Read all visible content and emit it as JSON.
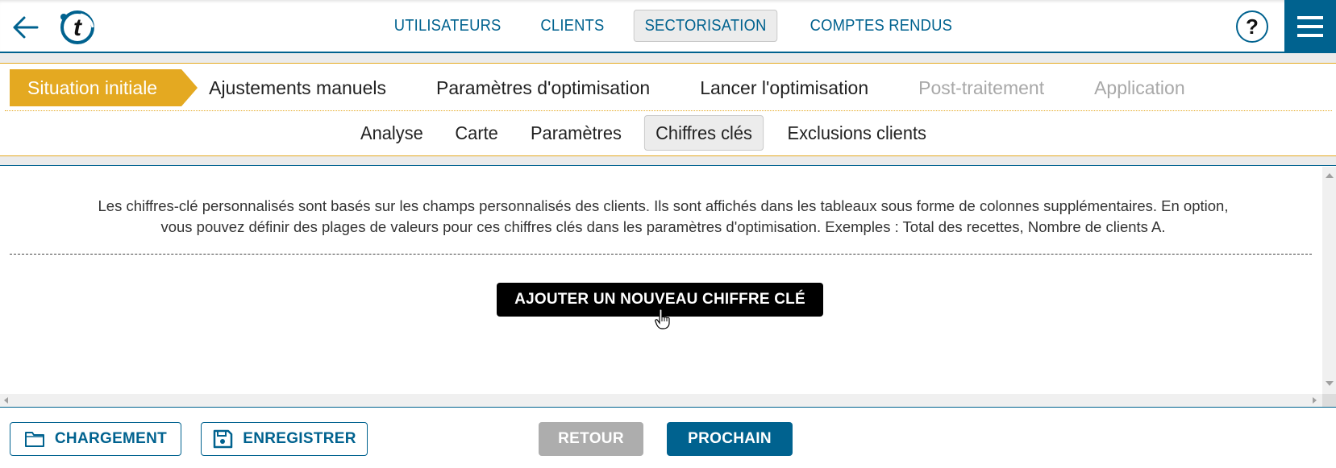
{
  "header": {
    "back_icon": "arrow-left-icon",
    "logo_letter": "t",
    "nav": [
      {
        "label": "UTILISATEURS",
        "active": false
      },
      {
        "label": "CLIENTS",
        "active": false
      },
      {
        "label": "SECTORISATION",
        "active": true
      },
      {
        "label": "COMPTES RENDUS",
        "active": false
      }
    ],
    "help_label": "?",
    "menu_icon": "hamburger-icon"
  },
  "steps": [
    {
      "label": "Situation initiale",
      "state": "active"
    },
    {
      "label": "Ajustements manuels",
      "state": "enabled"
    },
    {
      "label": "Paramètres d'optimisation",
      "state": "enabled"
    },
    {
      "label": "Lancer l'optimisation",
      "state": "enabled"
    },
    {
      "label": "Post-traitement",
      "state": "disabled"
    },
    {
      "label": "Application",
      "state": "disabled"
    }
  ],
  "subtabs": [
    {
      "label": "Analyse",
      "active": false
    },
    {
      "label": "Carte",
      "active": false
    },
    {
      "label": "Paramètres",
      "active": false
    },
    {
      "label": "Chiffres clés",
      "active": true
    },
    {
      "label": "Exclusions clients",
      "active": false
    }
  ],
  "content": {
    "description_line1": "Les chiffres-clé personnalisés sont basés sur les champs personnalisés des clients. Ils sont affichés dans les tableaux sous forme de colonnes supplémentaires. En option,",
    "description_line2": "vous pouvez définir des plages de valeurs pour ces chiffres clés dans les paramètres d'optimisation. Exemples : Total des recettes, Nombre de clients A.",
    "add_button_label": "AJOUTER UN NOUVEAU CHIFFRE CLÉ"
  },
  "footer": {
    "load_label": "CHARGEMENT",
    "save_label": "ENREGISTRER",
    "back_label": "RETOUR",
    "next_label": "PROCHAIN"
  },
  "colors": {
    "primary": "#00628f",
    "accent": "#e4a921",
    "disabled": "#adadad"
  }
}
